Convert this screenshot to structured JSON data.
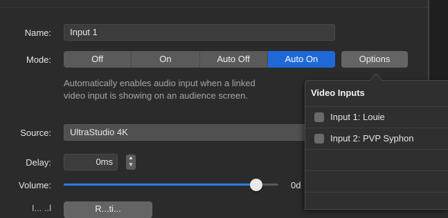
{
  "form": {
    "name_label": "Name:",
    "name_value": "Input 1",
    "mode_label": "Mode:",
    "mode_options": [
      "Off",
      "On",
      "Auto Off",
      "Auto On"
    ],
    "mode_selected": "Auto On",
    "options_button": "Options",
    "description_line1": "Automatically enables audio input when a linked",
    "description_line2": "video input is showing on an audience screen.",
    "source_label": "Source:",
    "source_value": "UltraStudio 4K",
    "delay_label": "Delay:",
    "delay_value": "0ms",
    "volume_label": "Volume:",
    "volume_value_text": "0d",
    "volume_level": 0.87,
    "partial_label": "I... ..l",
    "partial_button": "R...ti..."
  },
  "popover": {
    "title": "Video Inputs",
    "items": [
      {
        "label": "Input 1: Louie",
        "checked": false
      },
      {
        "label": "Input 2: PVP Syphon",
        "checked": false
      }
    ]
  },
  "colors": {
    "accent": "#1f68d8",
    "slider_fill": "#2e7cf6",
    "background": "#2b2b2b"
  }
}
